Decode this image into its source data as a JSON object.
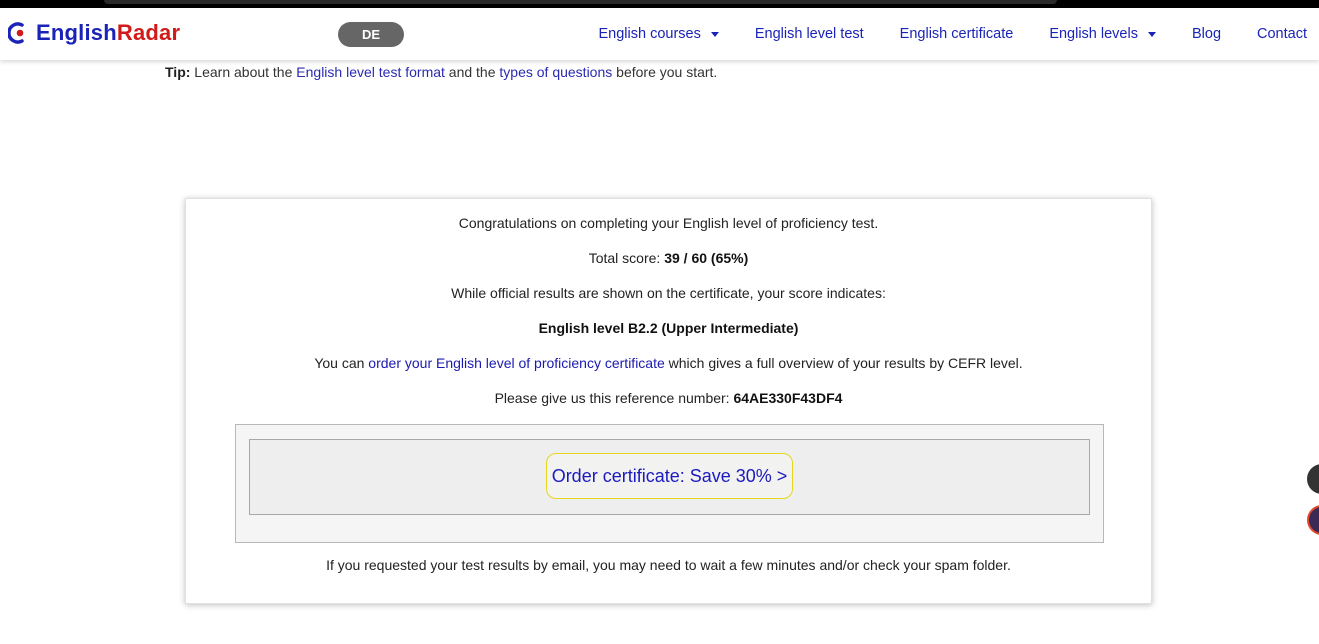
{
  "header": {
    "logo_english": "English",
    "logo_radar": "Radar",
    "language_button": "DE",
    "nav": [
      {
        "label": "English courses",
        "dropdown": true
      },
      {
        "label": "English level test",
        "dropdown": false
      },
      {
        "label": "English certificate",
        "dropdown": false
      },
      {
        "label": "English levels",
        "dropdown": true
      },
      {
        "label": "Blog",
        "dropdown": false
      },
      {
        "label": "Contact",
        "dropdown": false
      }
    ]
  },
  "tip": {
    "label": "Tip:",
    "text_before": "Learn about the",
    "link_format": "English level test format",
    "text_middle": "and the",
    "link_questions": "types of questions",
    "text_after": "before you start."
  },
  "result": {
    "congrats": "Congratulations on completing your English level of proficiency test.",
    "score_label": "Total score:",
    "score_value": "39 / 60 (65%)",
    "indicates": "While official results are shown on the certificate, your score indicates:",
    "level": "English level B2.2 (Upper Intermediate)",
    "order_prefix": "You can",
    "order_link": "order your English level of proficiency certificate",
    "order_suffix": "which gives a full overview of your results by CEFR level.",
    "reference_label": "Please give us this reference number:",
    "reference_value": "64AE330F43DF4",
    "order_button": "Order certificate: Save 30% >",
    "email_note": "If you requested your test results by email, you may need to wait a few minutes and/or check your spam folder."
  },
  "colors": {
    "brand_blue": "#1a23b8",
    "brand_red": "#d11a1a",
    "link_blue": "#1a1ab0",
    "button_border": "#e7d51e"
  }
}
